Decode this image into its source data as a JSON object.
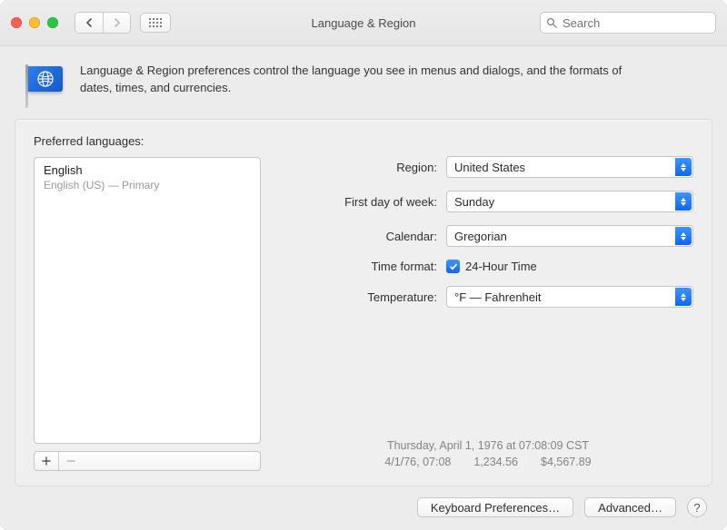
{
  "window": {
    "title": "Language & Region"
  },
  "search": {
    "placeholder": "Search"
  },
  "intro": "Language & Region preferences control the language you see in menus and dialogs, and the formats of dates, times, and currencies.",
  "left": {
    "heading": "Preferred languages:",
    "lang_name": "English",
    "lang_sub": "English (US) — Primary"
  },
  "form": {
    "region_label": "Region:",
    "region_value": "United States",
    "firstday_label": "First day of week:",
    "firstday_value": "Sunday",
    "calendar_label": "Calendar:",
    "calendar_value": "Gregorian",
    "timefmt_label": "Time format:",
    "timefmt_check_label": "24-Hour Time",
    "timefmt_checked": true,
    "temp_label": "Temperature:",
    "temp_value": "°F — Fahrenheit"
  },
  "examples": {
    "line1": "Thursday, April 1, 1976 at 07:08:09 CST",
    "line2": "4/1/76, 07:08  1,234.56  $4,567.89"
  },
  "footer": {
    "keyboard": "Keyboard Preferences…",
    "advanced": "Advanced…",
    "help": "?"
  }
}
